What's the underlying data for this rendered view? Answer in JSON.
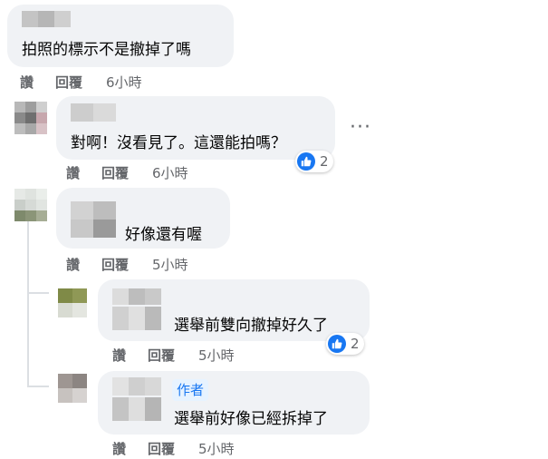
{
  "actions": {
    "like": "讚",
    "reply": "回覆"
  },
  "comments": [
    {
      "text": "拍照的標示不是撤掉了嗎",
      "time": "6小時"
    },
    {
      "text": "對啊！沒看見了。這還能拍嗎？",
      "time": "6小時",
      "reactions": "2",
      "more": "···"
    },
    {
      "text": "好像還有喔",
      "time": "5小時"
    },
    {
      "text": "選舉前雙向撤掉好久了",
      "time": "5小時",
      "reactions": "2"
    },
    {
      "text": "選舉前好像已經拆掉了",
      "time": "5小時",
      "badge": "作者"
    }
  ],
  "colors": {
    "bubble": "#f0f2f5",
    "meta": "#65676b",
    "like": "#1877f2",
    "badge_bg": "#e7f3ff"
  },
  "icons": {
    "reaction": "thumbs-up-icon",
    "menu": "more-icon"
  }
}
